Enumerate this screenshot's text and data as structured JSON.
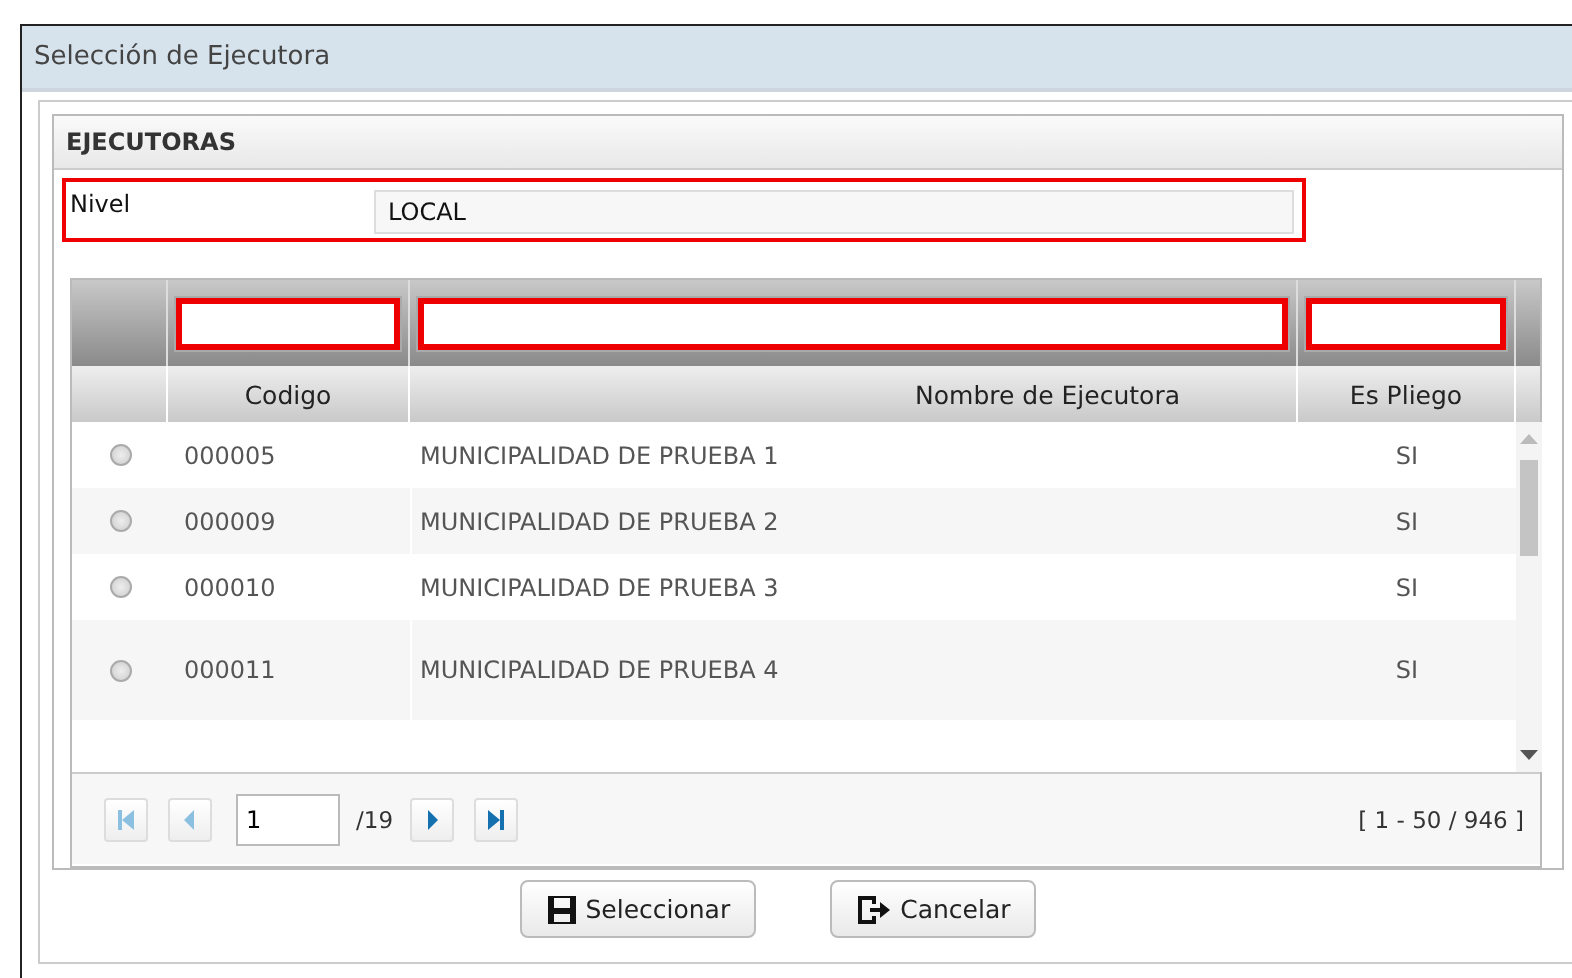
{
  "window": {
    "title": "Selección de Ejecutora"
  },
  "panel": {
    "title": "EJECUTORAS"
  },
  "nivel": {
    "label": "Nivel",
    "value": "LOCAL"
  },
  "table": {
    "columns": [
      "Codigo",
      "Nombre de Ejecutora",
      "Es Pliego"
    ],
    "rows": [
      {
        "selected": false,
        "codigo": "000005",
        "nombre": "MUNICIPALIDAD DE PRUEBA 1",
        "es_pliego": "SI"
      },
      {
        "selected": false,
        "codigo": "000009",
        "nombre": "MUNICIPALIDAD DE PRUEBA 2",
        "es_pliego": "SI"
      },
      {
        "selected": false,
        "codigo": "000010",
        "nombre": "MUNICIPALIDAD DE PRUEBA 3",
        "es_pliego": "SI"
      },
      {
        "selected": false,
        "codigo": "000011",
        "nombre": "MUNICIPALIDAD DE PRUEBA 4",
        "es_pliego": "SI"
      }
    ]
  },
  "pager": {
    "page": "1",
    "total_pages": "/19",
    "range": "[ 1 - 50 / 946 ]"
  },
  "buttons": [
    {
      "kind": "save",
      "label": "Seleccionar"
    },
    {
      "kind": "exit",
      "label": "Cancelar"
    }
  ]
}
